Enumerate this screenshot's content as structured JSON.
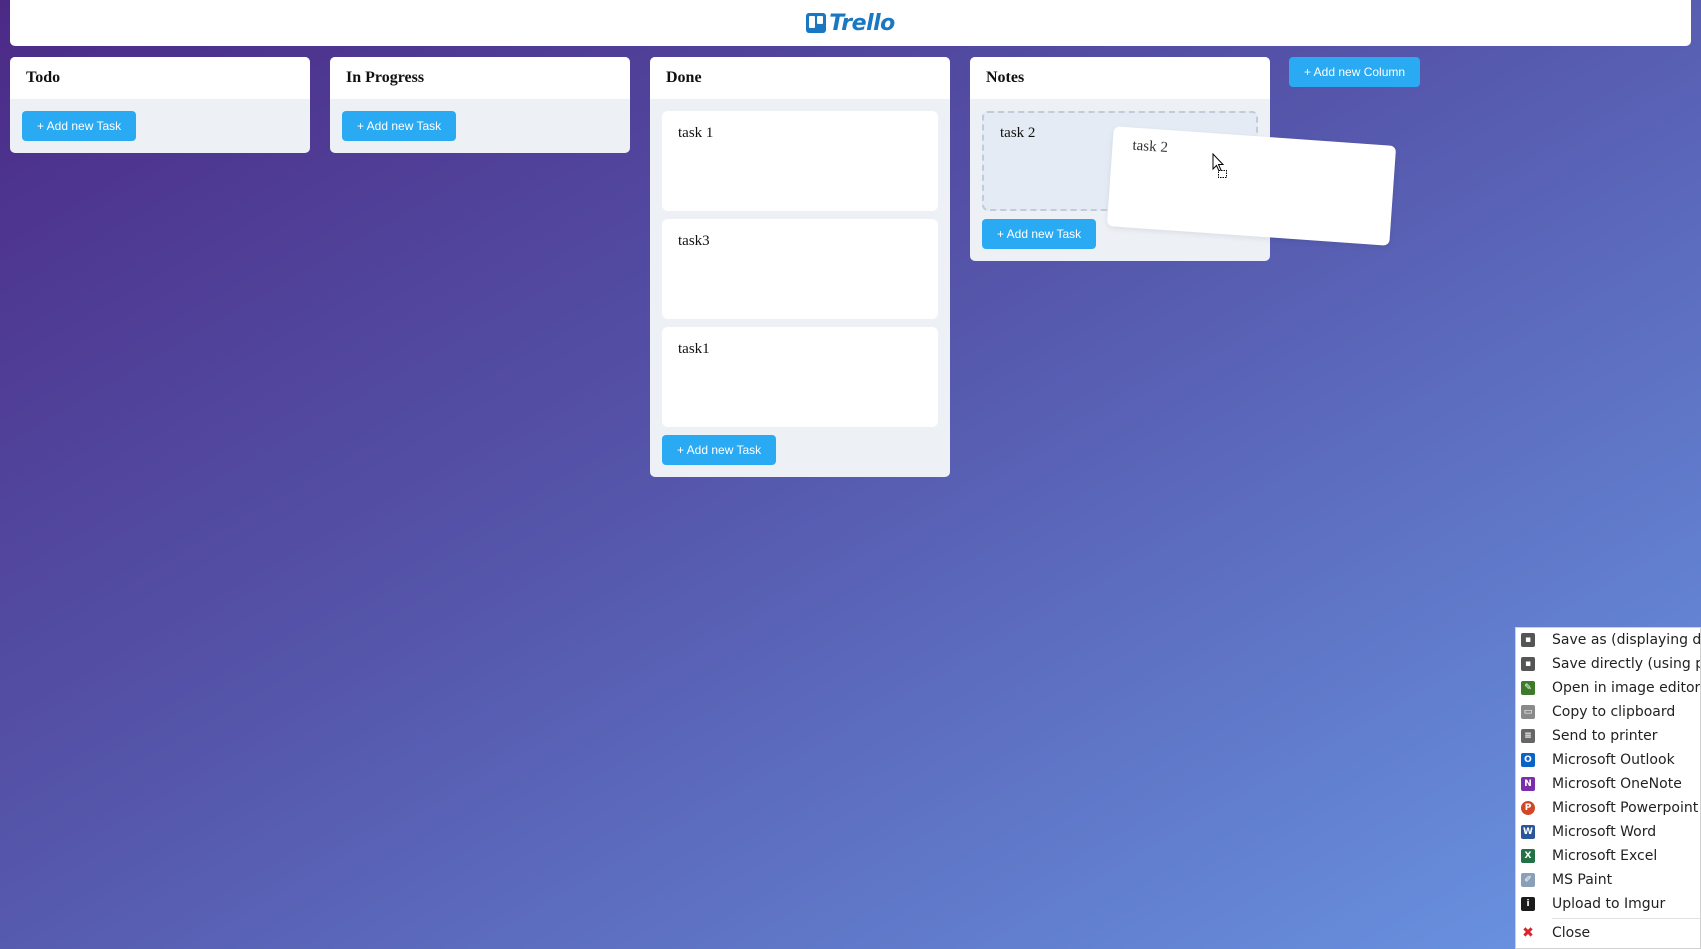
{
  "app": {
    "logo_text": "Trello"
  },
  "board": {
    "columns": [
      {
        "title": "Todo",
        "cards": [],
        "add_task_label": "+ Add new Task"
      },
      {
        "title": "In Progress",
        "cards": [],
        "add_task_label": "+ Add new Task"
      },
      {
        "title": "Done",
        "cards": [
          "task 1",
          "task3",
          "task1"
        ],
        "add_task_label": "+ Add new Task"
      },
      {
        "title": "Notes",
        "cards": [
          "task 2"
        ],
        "add_task_label": "+ Add new Task"
      }
    ],
    "add_column_label": "+ Add new Column",
    "dragging_card": "task 2"
  },
  "context_menu": {
    "items": [
      {
        "label": "Save as (displaying dialog)",
        "icon": "save-icon",
        "color": "#555555"
      },
      {
        "label": "Save directly (using preferences)",
        "icon": "save-icon",
        "color": "#555555"
      },
      {
        "label": "Open in image editor",
        "icon": "image-editor-icon",
        "color": "#3d7a2a"
      },
      {
        "label": "Copy to clipboard",
        "icon": "clipboard-icon",
        "color": "#8a8a8a"
      },
      {
        "label": "Send to printer",
        "icon": "printer-icon",
        "color": "#666666"
      },
      {
        "label": "Microsoft Outlook",
        "icon": "outlook-icon",
        "color": "#0a64c8"
      },
      {
        "label": "Microsoft OneNote",
        "icon": "onenote-icon",
        "color": "#7a2fa8"
      },
      {
        "label": "Microsoft Powerpoint",
        "icon": "powerpoint-icon",
        "color": "#d24726"
      },
      {
        "label": "Microsoft Word",
        "icon": "word-icon",
        "color": "#2b579a"
      },
      {
        "label": "Microsoft Excel",
        "icon": "excel-icon",
        "color": "#217346"
      },
      {
        "label": "MS Paint",
        "icon": "paint-icon",
        "color": "#8aa0b8"
      },
      {
        "label": "Upload to Imgur",
        "icon": "imgur-icon",
        "color": "#1b1b1b"
      },
      {
        "label": "Close",
        "icon": "close-icon",
        "color": "#d9262e"
      }
    ]
  }
}
